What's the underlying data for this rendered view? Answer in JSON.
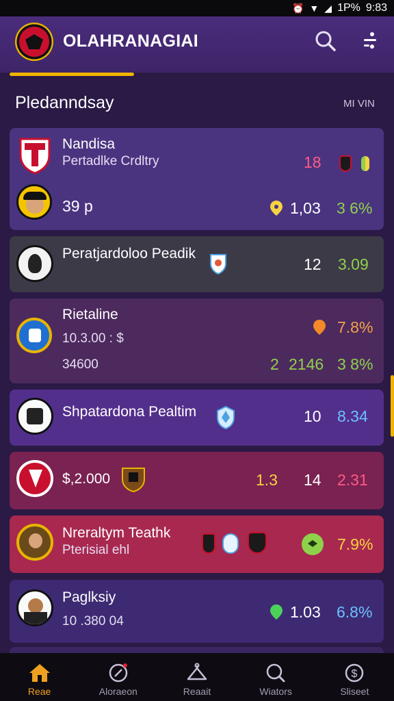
{
  "status_bar": {
    "battery": "1P%",
    "time": "9:83"
  },
  "app_bar": {
    "title": "OLAHRANAGIAI"
  },
  "section": {
    "title": "Pledanndsay",
    "link": "MI VIN"
  },
  "cards": [
    {
      "title": "Nandisa",
      "subtitle": "Pertadlke Crdltry",
      "score": "18",
      "stat_1": "39 p",
      "stat_2": "1,03",
      "stat_3": "3 6%"
    },
    {
      "title": "Peratjardoloo Peadik",
      "stat_1": "12",
      "stat_2": "3.09"
    },
    {
      "title": "Rietaline",
      "subtitle": "10.3.00 : $",
      "stat_0": "7.8%",
      "stat_1": "34600",
      "stat_2": "2",
      "stat_3": "2146",
      "stat_4": "3 8%"
    },
    {
      "title": "Shpatardona Pealtim",
      "stat_1": "10",
      "stat_2": "8.34"
    },
    {
      "title": "$,2.000",
      "stat_1": "1.3",
      "stat_2": "14",
      "stat_3": "2.31"
    },
    {
      "title": "Nreraltym Teathk",
      "subtitle": "Pterisial ehl",
      "stat_1": "7.9%"
    },
    {
      "title": "Paglksiy",
      "subtitle": "10 .380 04",
      "stat_1": "1.03",
      "stat_2": "6.8%"
    }
  ],
  "bottom_nav": [
    {
      "label": "Reae",
      "icon": "home-icon",
      "active": true
    },
    {
      "label": "Aloraeon",
      "icon": "compass-icon"
    },
    {
      "label": "Reaait",
      "icon": "hanger-icon"
    },
    {
      "label": "Wiators",
      "icon": "search-icon"
    },
    {
      "label": "Sliseet",
      "icon": "dollar-icon"
    }
  ],
  "colors": {
    "accent": "#f0b400",
    "green": "#8fd14b",
    "pink": "#ff5a85",
    "orange": "#f2a24a",
    "blue": "#6cc1ff"
  }
}
